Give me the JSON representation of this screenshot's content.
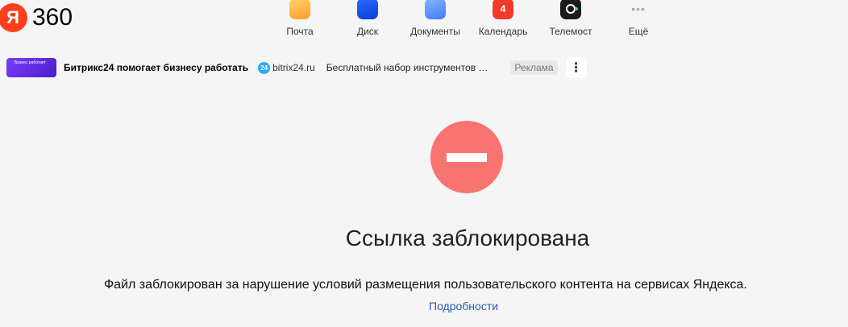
{
  "logo": {
    "mark": "Я",
    "text": "360"
  },
  "services": [
    {
      "label": "Почта",
      "icon": "mail-icon"
    },
    {
      "label": "Диск",
      "icon": "disk-icon"
    },
    {
      "label": "Документы",
      "icon": "documents-icon"
    },
    {
      "label": "Календарь",
      "icon": "calendar-icon",
      "badge": "4"
    },
    {
      "label": "Телемост",
      "icon": "telemost-icon"
    },
    {
      "label": "Ещё",
      "icon": "more-dots-icon",
      "glyph": "•••"
    }
  ],
  "ad": {
    "thumb_text": "Бизнес работает",
    "title": "Битрикс24 помогает бизнесу работать",
    "domain_badge": "24",
    "domain": "bitrix24.ru",
    "description": "Бесплатный набор инструментов …",
    "label": "Реклама",
    "menu_glyph": "⋮"
  },
  "status": {
    "heading": "Ссылка заблокирована",
    "description": "Файл заблокирован за нарушение условий размещения пользовательского контента на сервисах Яндекса.",
    "link": "Подробности"
  },
  "colors": {
    "accent_red": "#fc3f1d",
    "block_icon": "#f87470",
    "link": "#2a5db0",
    "background": "#f5f5f5"
  }
}
